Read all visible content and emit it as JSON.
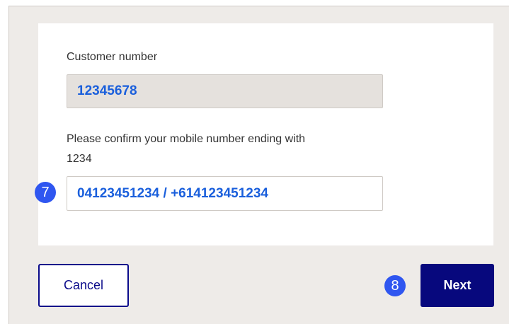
{
  "customer_number": {
    "label": "Customer number",
    "value": "12345678"
  },
  "mobile": {
    "label_line1": "Please confirm your mobile number ending with",
    "label_line2": "1234",
    "value": "04123451234 / +614123451234",
    "step_marker": "7"
  },
  "actions": {
    "cancel_label": "Cancel",
    "next_label": "Next",
    "next_step_marker": "8"
  },
  "colors": {
    "field_text": "#1a5fdc",
    "step_marker": "#2f56f0",
    "primary_button": "#07087d"
  }
}
